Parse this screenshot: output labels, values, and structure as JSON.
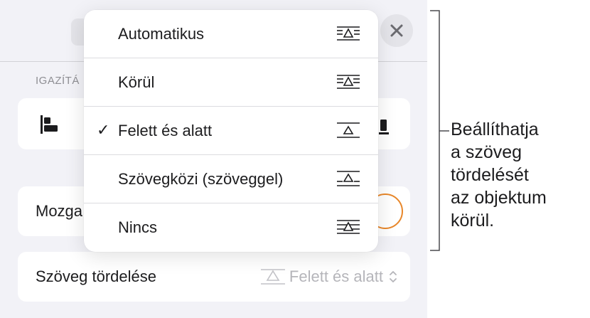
{
  "panel": {
    "section_header": "IGAZÍTÁ",
    "move_label": "Mozga",
    "wrap_label": "Szöveg tördelése",
    "wrap_value": "Felett és alatt",
    "accent_color": "#e8872a"
  },
  "menu": {
    "items": [
      {
        "label": "Automatikus",
        "icon": "wrap-automatic-icon",
        "checked": false
      },
      {
        "label": "Körül",
        "icon": "wrap-around-icon",
        "checked": false
      },
      {
        "label": "Felett és alatt",
        "icon": "wrap-above-below-icon",
        "checked": true
      },
      {
        "label": "Szövegközi (szöveggel)",
        "icon": "wrap-inline-icon",
        "checked": false
      },
      {
        "label": "Nincs",
        "icon": "wrap-none-icon",
        "checked": false
      }
    ],
    "check_glyph": "✓"
  },
  "callout": {
    "lines": [
      "Beállíthatja",
      "a szöveg",
      "tördelését",
      "az objektum",
      "körül."
    ]
  }
}
